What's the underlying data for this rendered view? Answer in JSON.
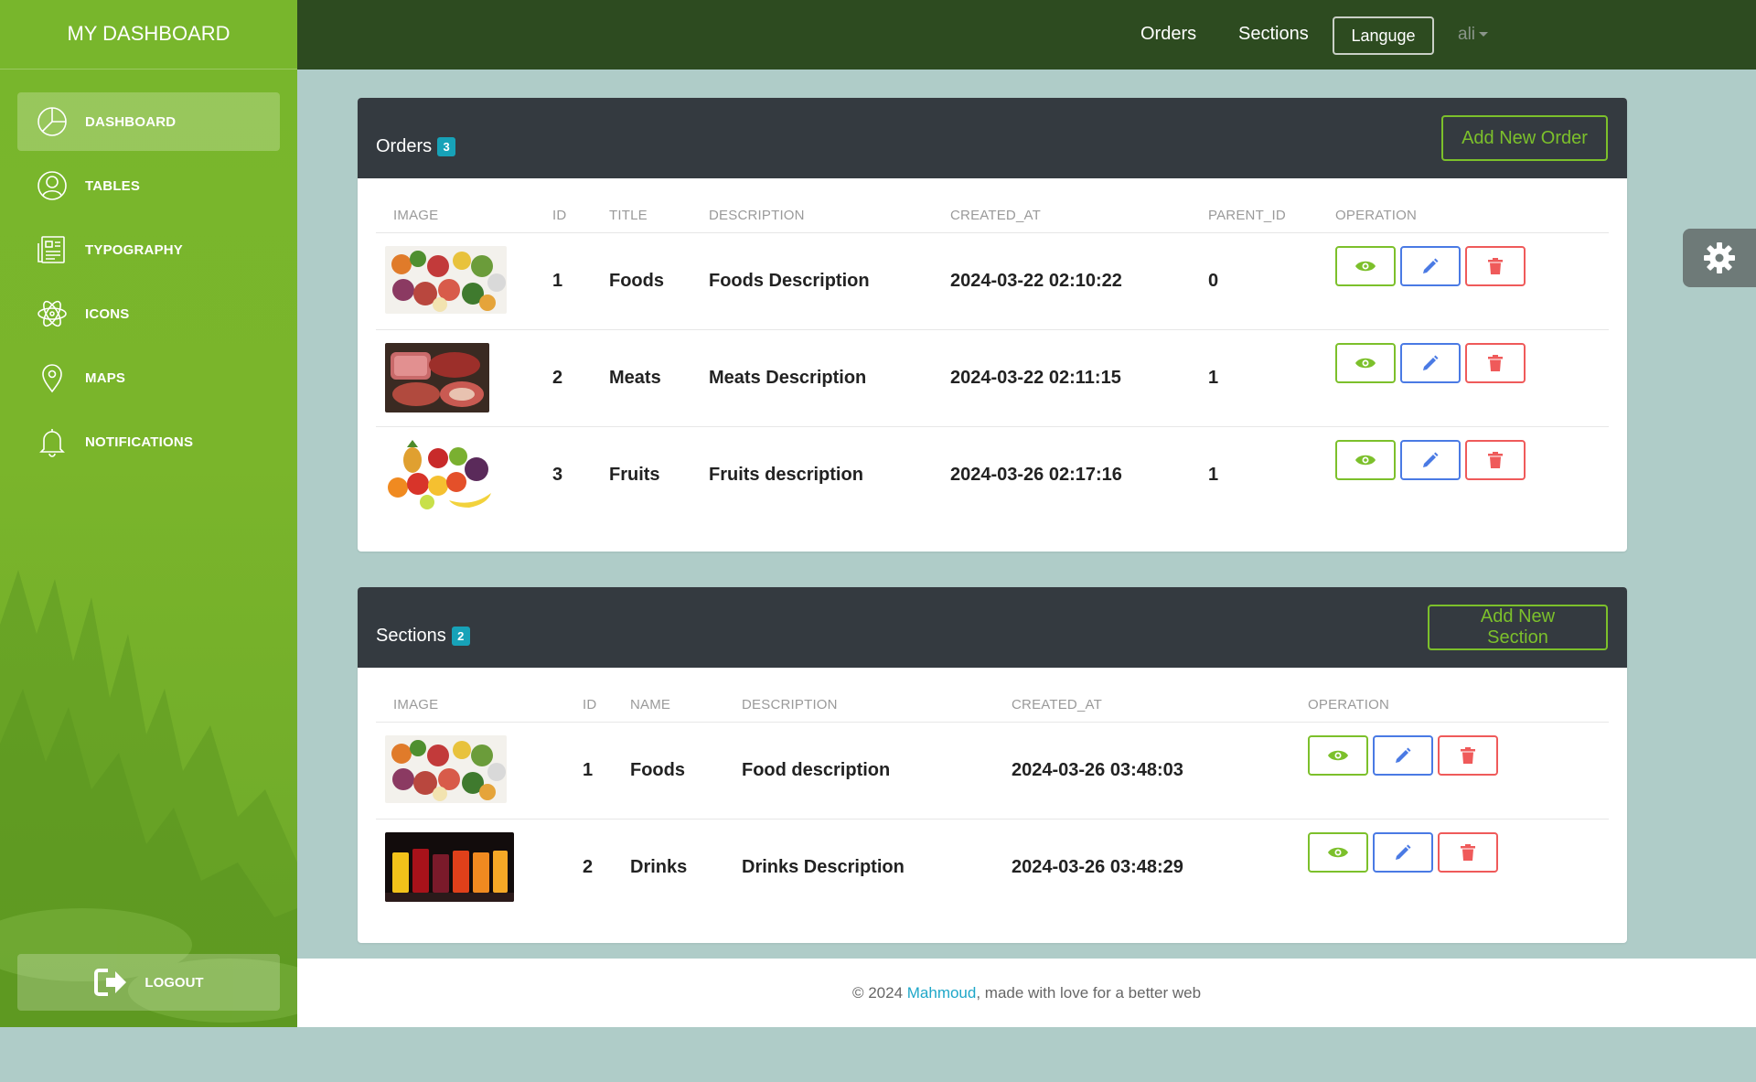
{
  "sidebar": {
    "brand": "MY DASHBOARD",
    "items": [
      {
        "label": "DASHBOARD",
        "icon": "pie-chart-icon",
        "active": true
      },
      {
        "label": "TABLES",
        "icon": "user-circle-icon",
        "active": false
      },
      {
        "label": "TYPOGRAPHY",
        "icon": "news-paper-icon",
        "active": false
      },
      {
        "label": "ICONS",
        "icon": "atom-icon",
        "active": false
      },
      {
        "label": "MAPS",
        "icon": "map-pin-icon",
        "active": false
      },
      {
        "label": "NOTIFICATIONS",
        "icon": "bell-icon",
        "active": false
      }
    ],
    "logout": {
      "label": "LOGOUT",
      "icon": "sign-out-icon"
    }
  },
  "topbar": {
    "links": {
      "orders": "Orders",
      "sections": "Sections"
    },
    "language_button": "Languge",
    "user": "ali"
  },
  "orders": {
    "title": "Orders",
    "count": "3",
    "add_button": "Add New Order",
    "columns": [
      "IMAGE",
      "ID",
      "TITLE",
      "DESCRIPTION",
      "CREATED_AT",
      "PARENT_ID",
      "OPERATION"
    ],
    "rows": [
      {
        "image": "foods",
        "id": "1",
        "title": "Foods",
        "description": "Foods Description",
        "created_at": "2024-03-22 02:10:22",
        "parent_id": "0"
      },
      {
        "image": "meats",
        "id": "2",
        "title": "Meats",
        "description": "Meats Description",
        "created_at": "2024-03-22 02:11:15",
        "parent_id": "1"
      },
      {
        "image": "fruits",
        "id": "3",
        "title": "Fruits",
        "description": "Fruits description",
        "created_at": "2024-03-26 02:17:16",
        "parent_id": "1"
      }
    ]
  },
  "sections": {
    "title": "Sections",
    "count": "2",
    "add_button": "Add New Section",
    "columns": [
      "IMAGE",
      "ID",
      "NAME",
      "DESCRIPTION",
      "CREATED_AT",
      "OPERATION"
    ],
    "rows": [
      {
        "image": "foods",
        "id": "1",
        "name": "Foods",
        "description": "Food description",
        "created_at": "2024-03-26 03:48:03"
      },
      {
        "image": "drinks",
        "id": "2",
        "name": "Drinks",
        "description": "Drinks Description",
        "created_at": "2024-03-26 03:48:29"
      }
    ]
  },
  "operations": {
    "view_icon": "eye-icon",
    "edit_icon": "pencil-icon",
    "delete_icon": "trash-icon"
  },
  "footer": {
    "copyright": "© 2024 ",
    "author": "Mahmoud",
    "tagline": ", made with love for a better web"
  },
  "colors": {
    "sidebar": "#7ab52b",
    "topbar": "#2d4b20",
    "card_header": "#343a40",
    "accent_green": "#7cc02b",
    "badge": "#17a2b8",
    "edit_blue": "#4a7ae4",
    "delete_red": "#ef5a5a",
    "page_bg": "#afccc8"
  }
}
